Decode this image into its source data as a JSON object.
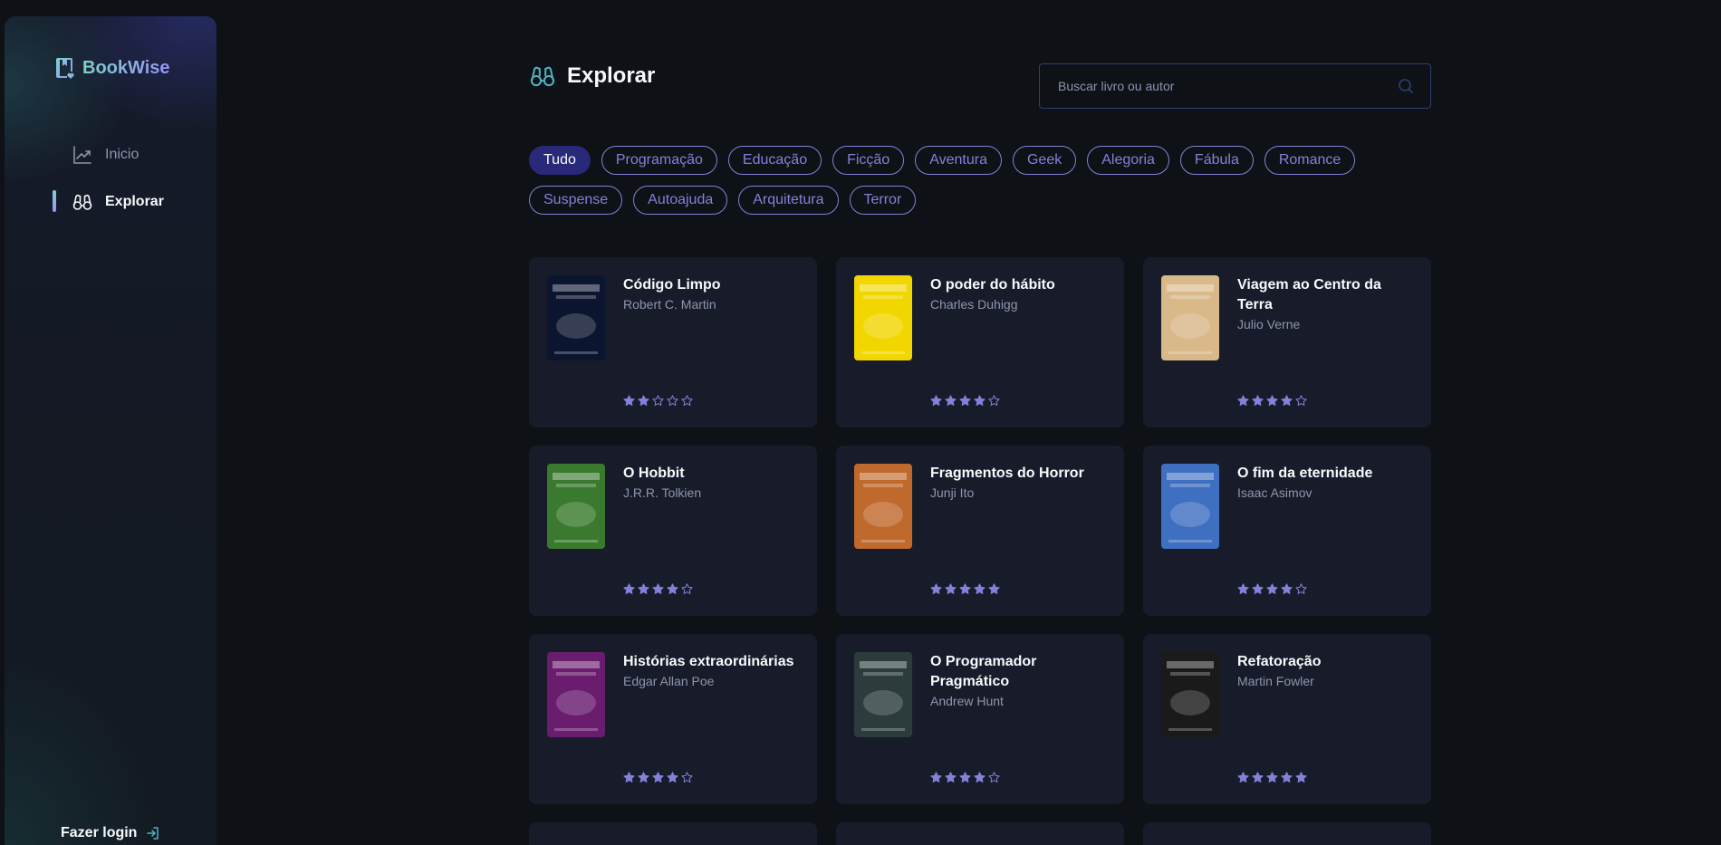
{
  "sidebar": {
    "brand": "BookWise",
    "nav": [
      {
        "label": "Inicio",
        "icon": "chart-line-icon",
        "active": false
      },
      {
        "label": "Explorar",
        "icon": "binoculars-icon",
        "active": true
      }
    ],
    "login_label": "Fazer login"
  },
  "header": {
    "title": "Explorar",
    "search_placeholder": "Buscar livro ou autor"
  },
  "tags": [
    "Tudo",
    "Programação",
    "Educação",
    "Ficção",
    "Aventura",
    "Geek",
    "Alegoria",
    "Fábula",
    "Romance",
    "Suspense",
    "Autoajuda",
    "Arquitetura",
    "Terror"
  ],
  "active_tag": "Tudo",
  "books": [
    {
      "title": "Código Limpo",
      "author": "Robert C. Martin",
      "rating": 2,
      "cover": "#0b1530"
    },
    {
      "title": "O poder do hábito",
      "author": "Charles Duhigg",
      "rating": 4,
      "cover": "#f2d600"
    },
    {
      "title": "Viagem ao Centro da Terra",
      "author": "Julio Verne",
      "rating": 4,
      "cover": "#d9b88a"
    },
    {
      "title": "O Hobbit",
      "author": "J.R.R. Tolkien",
      "rating": 4,
      "cover": "#3a7a2e"
    },
    {
      "title": "Fragmentos do Horror",
      "author": "Junji Ito",
      "rating": 5,
      "cover": "#c0692c"
    },
    {
      "title": "O fim da eternidade",
      "author": "Isaac Asimov",
      "rating": 4,
      "cover": "#3f6fc0"
    },
    {
      "title": "Histórias extraordinárias",
      "author": "Edgar Allan Poe",
      "rating": 4,
      "cover": "#6a1d6e"
    },
    {
      "title": "O Programador Pragmático",
      "author": "Andrew Hunt",
      "rating": 4,
      "cover": "#2c3c3c"
    },
    {
      "title": "Refatoração",
      "author": "Martin Fowler",
      "rating": 5,
      "cover": "#1a1a1a"
    }
  ],
  "colors": {
    "accent": "#8381d9",
    "tag_active": "#2a2879",
    "card": "#181c2a",
    "background": "#0e1116"
  }
}
